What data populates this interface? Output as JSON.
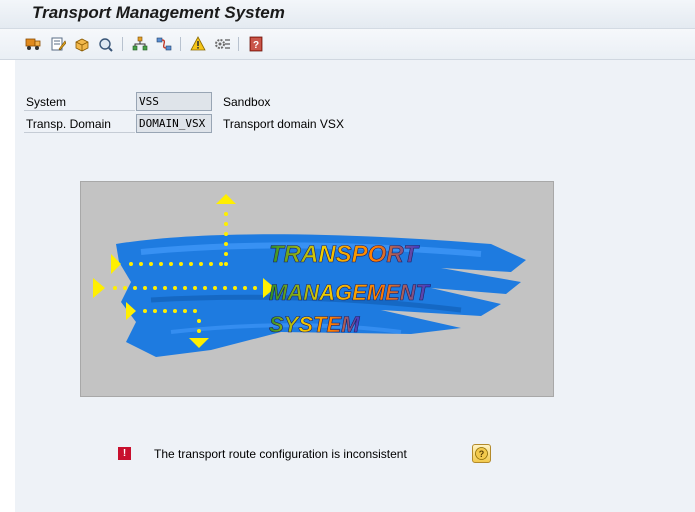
{
  "window": {
    "title": "Transport Management System"
  },
  "toolbar": {
    "buttons": [
      {
        "icon": "truck-icon"
      },
      {
        "icon": "edit-document-icon"
      },
      {
        "icon": "transport-box-icon"
      },
      {
        "icon": "display-icon"
      },
      {
        "icon": "hierarchy-icon"
      },
      {
        "icon": "transport-routes-icon"
      },
      {
        "icon": "alert-icon"
      },
      {
        "icon": "settings-icon"
      },
      {
        "icon": "help-book-icon"
      }
    ]
  },
  "form": {
    "system": {
      "label": "System",
      "value": "VSS",
      "description": "Sandbox"
    },
    "domain": {
      "label": "Transp. Domain",
      "value": "DOMAIN_VSX",
      "description": "Transport domain VSX"
    }
  },
  "logo": {
    "line1": "TRANSPORT",
    "line2": "MANAGEMENT",
    "line3": "SYSTEM"
  },
  "message": {
    "type": "error",
    "icon_text": "!",
    "text": "The transport route configuration is inconsistent",
    "help_icon": "help-icon"
  },
  "colors": {
    "error": "#c8102e",
    "logo_blue": "#1e7be0",
    "arrow_yellow": "#ffef00"
  }
}
